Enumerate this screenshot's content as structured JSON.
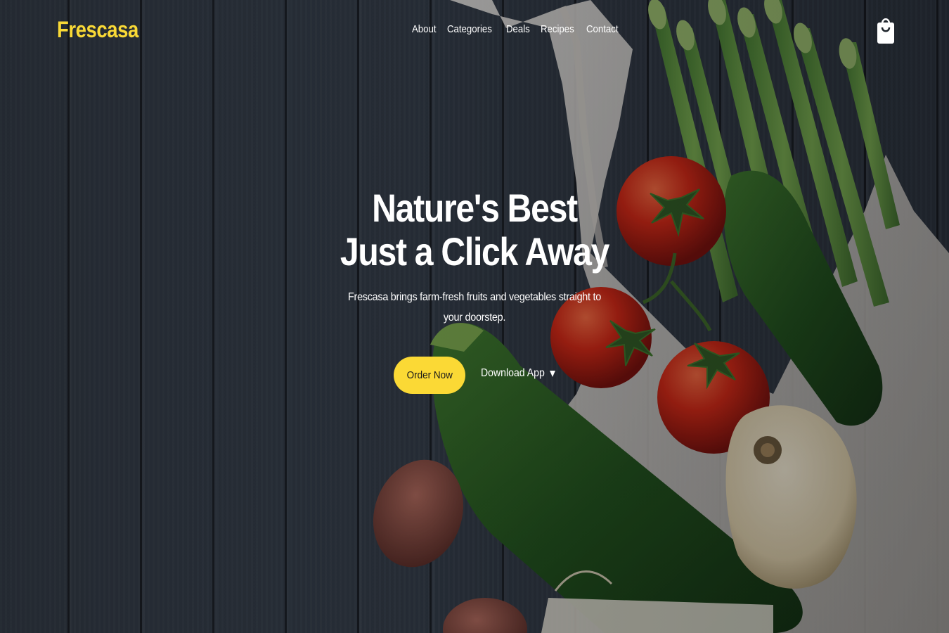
{
  "brand": {
    "name": "Frescasa",
    "color": "#f9d936"
  },
  "nav": {
    "items": [
      {
        "label": "About"
      },
      {
        "label": "Categories"
      },
      {
        "label": "Deals"
      },
      {
        "label": "Recipes"
      },
      {
        "label": "Contact"
      }
    ],
    "cart_icon": "shopping-bag-icon"
  },
  "hero": {
    "title_line1": "Nature's Best",
    "title_line2": "Just a Click Away",
    "subtitle": "Frescasa brings farm-fresh fruits and vegetables straight to your doorstep.",
    "primary_button": "Order Now",
    "secondary_button": "Download App",
    "secondary_icon": "caret-down-icon",
    "accent": "#fbd935"
  }
}
